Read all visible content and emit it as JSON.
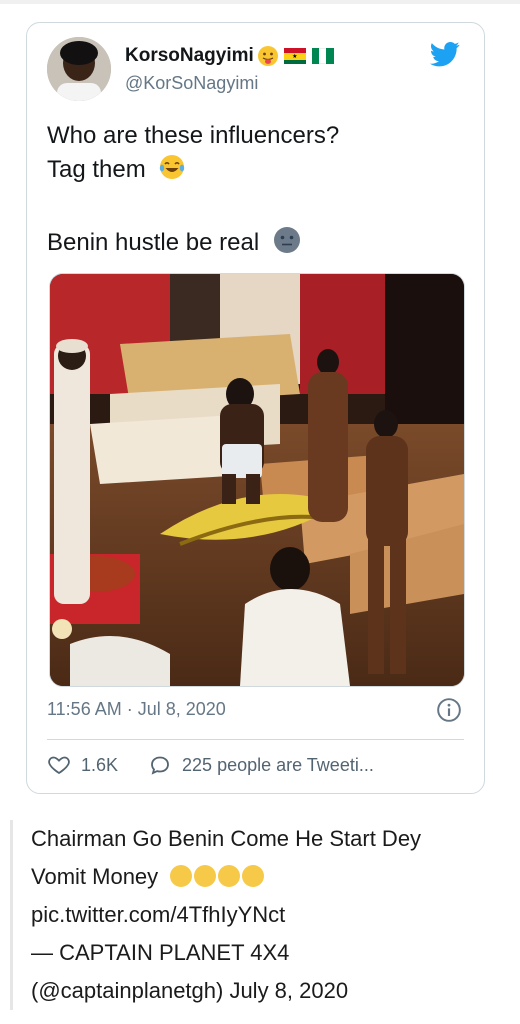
{
  "tweet": {
    "author_name": "KorsoNagyimi",
    "handle": "@KorSoNagyimi",
    "lines": [
      "Who are these influencers?",
      "Tag them",
      "Benin hustle be real"
    ],
    "timestamp": "11:56 AM · Jul 8, 2020",
    "likes": "1.6K",
    "replies_label": "225 people are Tweeti..."
  },
  "caption": {
    "line1": "Chairman Go Benin Come He Start Dey",
    "line2": "Vomit Money",
    "link": "pic.twitter.com/4TfhIyYNct",
    "attribution1": "— CAPTAIN PLANET 4X4",
    "attribution2": "(@captainplanetgh) July 8, 2020"
  },
  "colors": {
    "twitter_blue": "#1da1f2",
    "muted": "#657786",
    "border": "#cfd9de"
  }
}
